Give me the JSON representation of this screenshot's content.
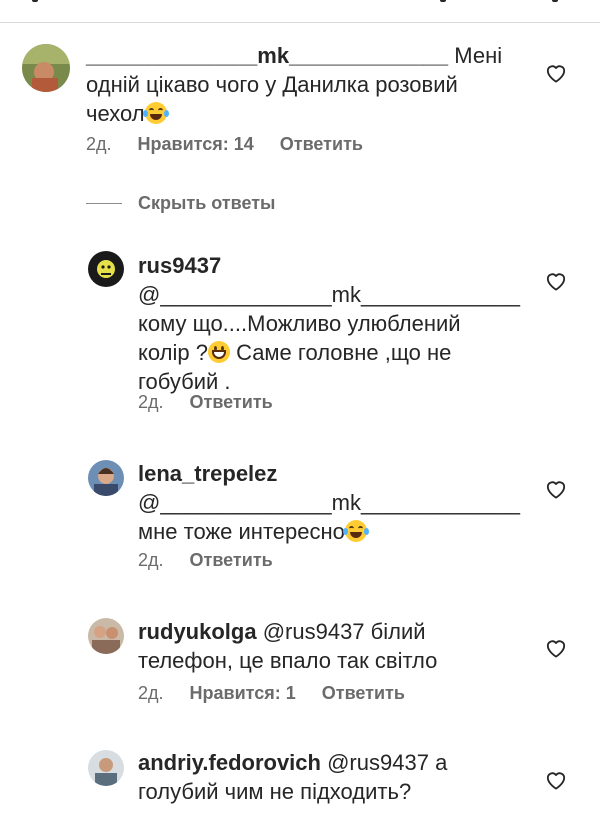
{
  "comments": [
    {
      "username": "______________mk_____________",
      "text_lines": [
        "Мені",
        "одній цікаво чого у Данилка розовий",
        "чехол"
      ],
      "emoji": "face-with-tears-of-joy",
      "time": "2д.",
      "likes": "Нравится: 14",
      "reply": "Ответить"
    }
  ],
  "hide_replies": "Скрыть ответы",
  "replies": [
    {
      "username": "rus9437",
      "mention": "@______________mk_____________",
      "lines": [
        "кому що....Можливо улюблений",
        "колір ?",
        "Саме головне ,що не",
        "гобубий ."
      ],
      "emoji": "grinning-face",
      "time": "2д.",
      "reply": "Ответить"
    },
    {
      "username": "lena_trepelez",
      "mention": "@______________mk_____________",
      "lines": [
        "мне тоже интересно"
      ],
      "emoji": "face-with-tears-of-joy",
      "time": "2д.",
      "reply": "Ответить"
    },
    {
      "username": "rudyukolga",
      "mention": "@rus9437",
      "lines": [
        "білий",
        "телефон, це впало так світло"
      ],
      "time": "2д.",
      "likes": "Нравится: 1",
      "reply": "Ответить"
    },
    {
      "username": "andriy.fedorovich",
      "mention": "@rus9437",
      "lines": [
        "а",
        "голубий чим не підходить?"
      ]
    }
  ],
  "icons": {
    "like": "heart-outline-icon"
  },
  "colors": {
    "text": "#262626",
    "meta": "#6b6b6b",
    "divider": "#dbdbdb"
  }
}
